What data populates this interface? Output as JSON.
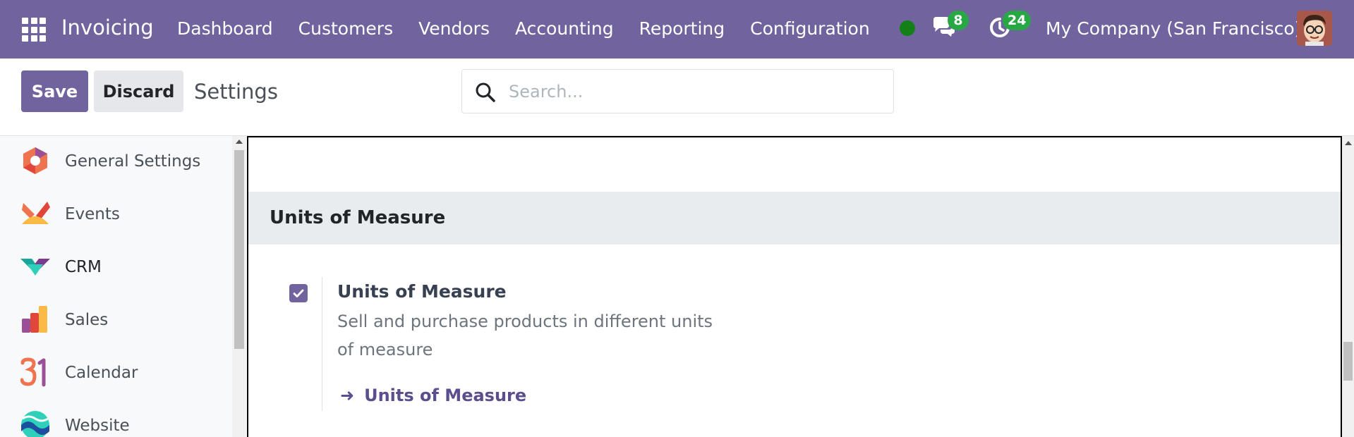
{
  "navbar": {
    "brand": "Invoicing",
    "menu": [
      "Dashboard",
      "Customers",
      "Vendors",
      "Accounting",
      "Reporting",
      "Configuration"
    ],
    "chat_badge": "8",
    "activity_badge": "24",
    "company": "My Company (San Francisco)",
    "colors": {
      "bar": "#71639e",
      "status": "#128016",
      "badge": "#28a745"
    }
  },
  "control": {
    "save_label": "Save",
    "discard_label": "Discard",
    "title": "Settings",
    "search_placeholder": "Search..."
  },
  "sidebar": {
    "items": [
      {
        "label": "General Settings",
        "icon": "general-settings-icon"
      },
      {
        "label": "Events",
        "icon": "events-icon"
      },
      {
        "label": "CRM",
        "icon": "crm-icon"
      },
      {
        "label": "Sales",
        "icon": "sales-icon"
      },
      {
        "label": "Calendar",
        "icon": "calendar-icon"
      },
      {
        "label": "Website",
        "icon": "website-icon"
      }
    ]
  },
  "section": {
    "title": "Units of Measure",
    "setting": {
      "checked": true,
      "title": "Units of Measure",
      "description": "Sell and purchase products in different units of measure",
      "link": "Units of Measure"
    }
  }
}
